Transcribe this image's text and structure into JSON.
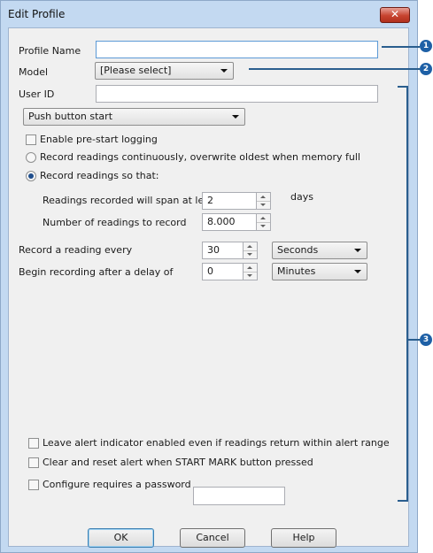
{
  "dialog": {
    "title": "Edit Profile",
    "close_symbol": "✕"
  },
  "profile": {
    "name_label": "Profile Name",
    "name_value": ""
  },
  "model": {
    "label": "Model",
    "selected": "[Please select]"
  },
  "user": {
    "label": "User ID",
    "value": ""
  },
  "start_mode": {
    "selected": "Push button start"
  },
  "options": {
    "pre_start_logging": "Enable pre-start logging",
    "continuous": "Record readings continuously, overwrite oldest when memory full",
    "record_so_that": "Record readings so that:"
  },
  "span": {
    "label": "Readings recorded will span at least",
    "value": "2",
    "unit": "days"
  },
  "count": {
    "label": "Number of readings to record",
    "value": "8.000"
  },
  "interval": {
    "label": "Record a reading every",
    "value": "30",
    "unit": "Seconds"
  },
  "delay": {
    "label": "Begin recording after a delay of",
    "value": "0",
    "unit": "Minutes"
  },
  "alerts": {
    "leave_enabled": "Leave alert indicator enabled even if readings return within alert range",
    "clear_reset": "Clear and reset alert when START MARK button pressed",
    "password": "Configure requires a password",
    "password_value": ""
  },
  "buttons": {
    "ok": "OK",
    "cancel": "Cancel",
    "help": "Help"
  },
  "callouts": [
    "1",
    "2",
    "3"
  ]
}
